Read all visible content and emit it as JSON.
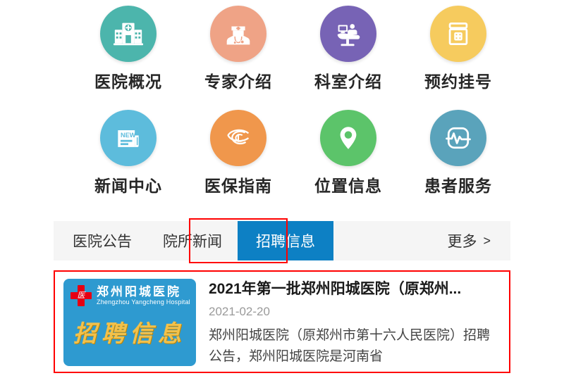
{
  "quick_links": {
    "rows": [
      [
        {
          "label": "医院概况",
          "icon": "hospital-building-icon",
          "color": "#4cb5ac"
        },
        {
          "label": "专家介绍",
          "icon": "doctor-icon",
          "color": "#efa386"
        },
        {
          "label": "科室介绍",
          "icon": "examination-icon",
          "color": "#7763b5"
        },
        {
          "label": "预约挂号",
          "icon": "medicine-jar-icon",
          "color": "#f6cb5e"
        }
      ],
      [
        {
          "label": "新闻中心",
          "icon": "newspaper-icon",
          "color": "#5dbcdc"
        },
        {
          "label": "医保指南",
          "icon": "insurance-csi-icon",
          "color": "#f0974c"
        },
        {
          "label": "位置信息",
          "icon": "map-pin-icon",
          "color": "#5cc46a"
        },
        {
          "label": "患者服务",
          "icon": "heartbeat-monitor-icon",
          "color": "#5aa3bb"
        }
      ]
    ]
  },
  "tabs": {
    "items": [
      {
        "label": "医院公告",
        "active": false
      },
      {
        "label": "院所新闻",
        "active": false
      },
      {
        "label": "招聘信息",
        "active": true
      }
    ],
    "more_label": "更多",
    "more_chevron": ">",
    "active_color": "#0d80c4",
    "bar_background": "#f5f5f5",
    "highlight_color": "#ff0000"
  },
  "news_card": {
    "thumbnail": {
      "hospital_name_cn": "郑州阳城医院",
      "hospital_name_en": "Zhengzhou Yangcheng Hospital",
      "slogan": "招聘信息",
      "logo_mark": "医",
      "background": "#2e9ad0",
      "slogan_color": "#f2c14b",
      "cross_color": "#e60012"
    },
    "title": "2021年第一批郑州阳城医院（原郑州...",
    "date": "2021-02-20",
    "description": "郑州阳城医院（原郑州市第十六人民医院）招聘公告，郑州阳城医院是河南省",
    "highlight_color": "#ff0000"
  }
}
